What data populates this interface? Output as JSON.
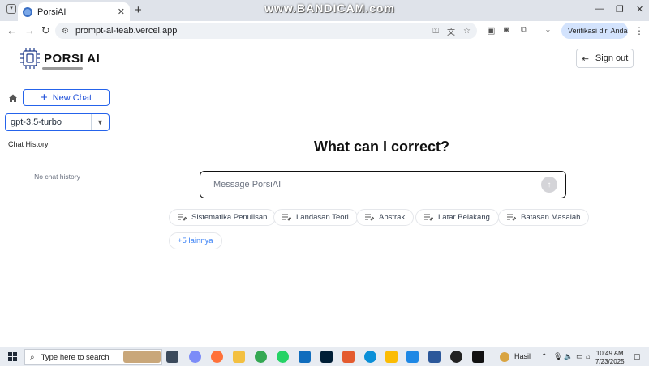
{
  "browser": {
    "tab_title": "PorsiAI",
    "tab_close": "✕",
    "new_tab": "+",
    "watermark": "www.BANDICAM.com",
    "url": "prompt-ai-teab.vercel.app",
    "profile_label": "Verifikasi diri Anda",
    "window_controls": [
      "—",
      "❐",
      "✕"
    ]
  },
  "sidebar": {
    "logo_text": "PORSI AI",
    "new_chat_label": "New Chat",
    "model_selected": "gpt-3.5-turbo",
    "history_title": "Chat History",
    "history_empty": "No chat history"
  },
  "header": {
    "signout_label": "Sign out"
  },
  "main": {
    "headline": "What can I correct?",
    "message_placeholder": "Message PorsiAI",
    "suggestions": [
      "Sistematika Penulisan",
      "Landasan Teori",
      "Abstrak",
      "Latar Belakang",
      "Batasan Masalah"
    ],
    "more_label": "+5 lainnya"
  },
  "taskbar": {
    "search_placeholder": "Type here to search",
    "weather_label": "Hasil",
    "time": "10:49 AM",
    "date": "7/23/2025"
  },
  "colors": {
    "accent": "#2563eb",
    "text": "#111111",
    "muted": "#6b7280",
    "border": "#e5e7eb"
  },
  "icons": {
    "tab_favicon": "porsi-favicon-icon",
    "back": "arrow-left-icon",
    "forward": "arrow-right-icon",
    "reload": "reload-icon",
    "home": "home-icon",
    "plus": "plus-icon",
    "chevron": "chevron-down-icon",
    "signout": "signout-icon",
    "send": "arrow-up-icon",
    "suggestion": "edit-note-icon"
  }
}
